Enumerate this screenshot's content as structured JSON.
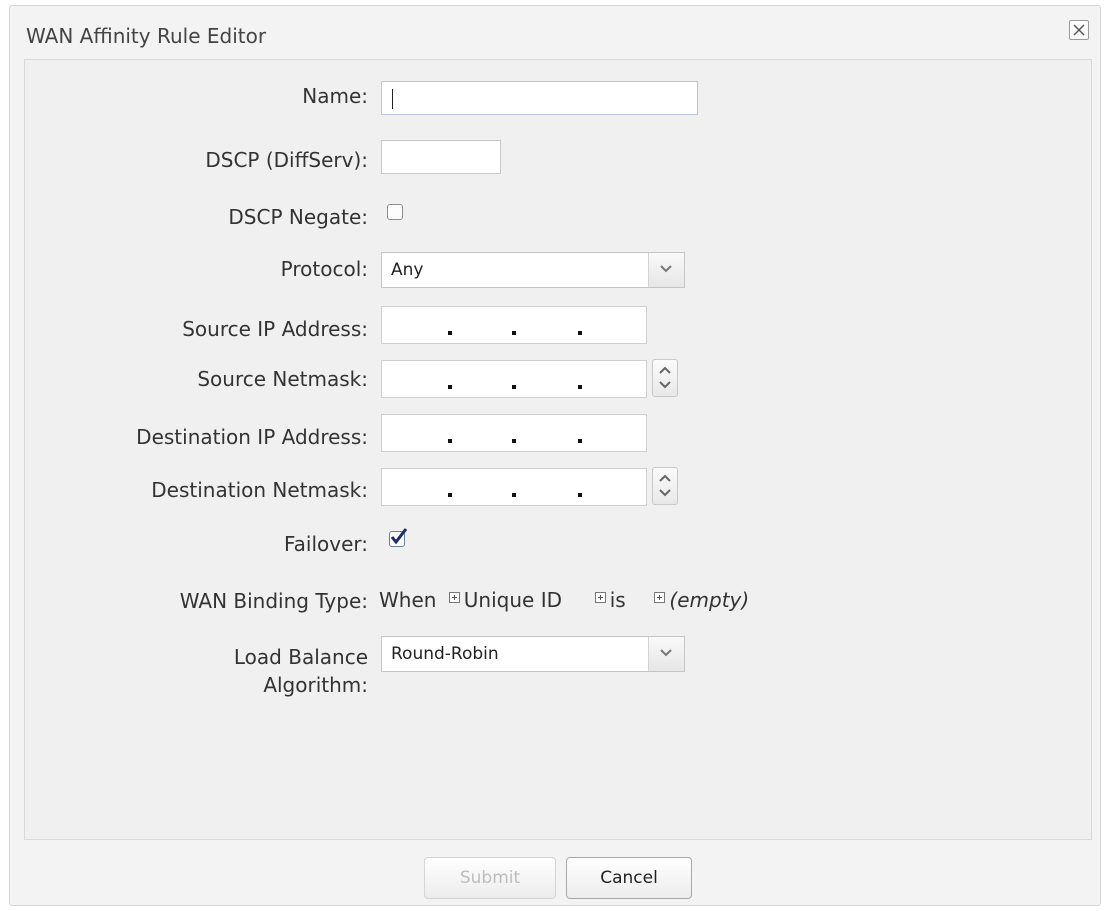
{
  "dialog": {
    "title": "WAN Affinity Rule Editor",
    "close_icon": "close-icon"
  },
  "form": {
    "name_label": "Name:",
    "name_value": "",
    "dscp_label": "DSCP (DiffServ):",
    "dscp_value": "",
    "dscp_negate_label": "DSCP Negate:",
    "dscp_negate_checked": false,
    "protocol_label": "Protocol:",
    "protocol_value": "Any",
    "source_ip_label": "Source IP Address:",
    "source_netmask_label": "Source Netmask:",
    "destination_ip_label": "Destination IP Address:",
    "destination_netmask_label": "Destination Netmask:",
    "failover_label": "Failover:",
    "failover_checked": true,
    "wan_binding_label": "WAN Binding Type:",
    "wan_binding": {
      "when": "When",
      "field": "Unique ID",
      "operator": "is",
      "value": "(empty)"
    },
    "load_balance_label_line1": "Load Balance",
    "load_balance_label_line2": "Algorithm:",
    "load_balance_value": "Round-Robin"
  },
  "footer": {
    "submit_label": "Submit",
    "cancel_label": "Cancel"
  }
}
